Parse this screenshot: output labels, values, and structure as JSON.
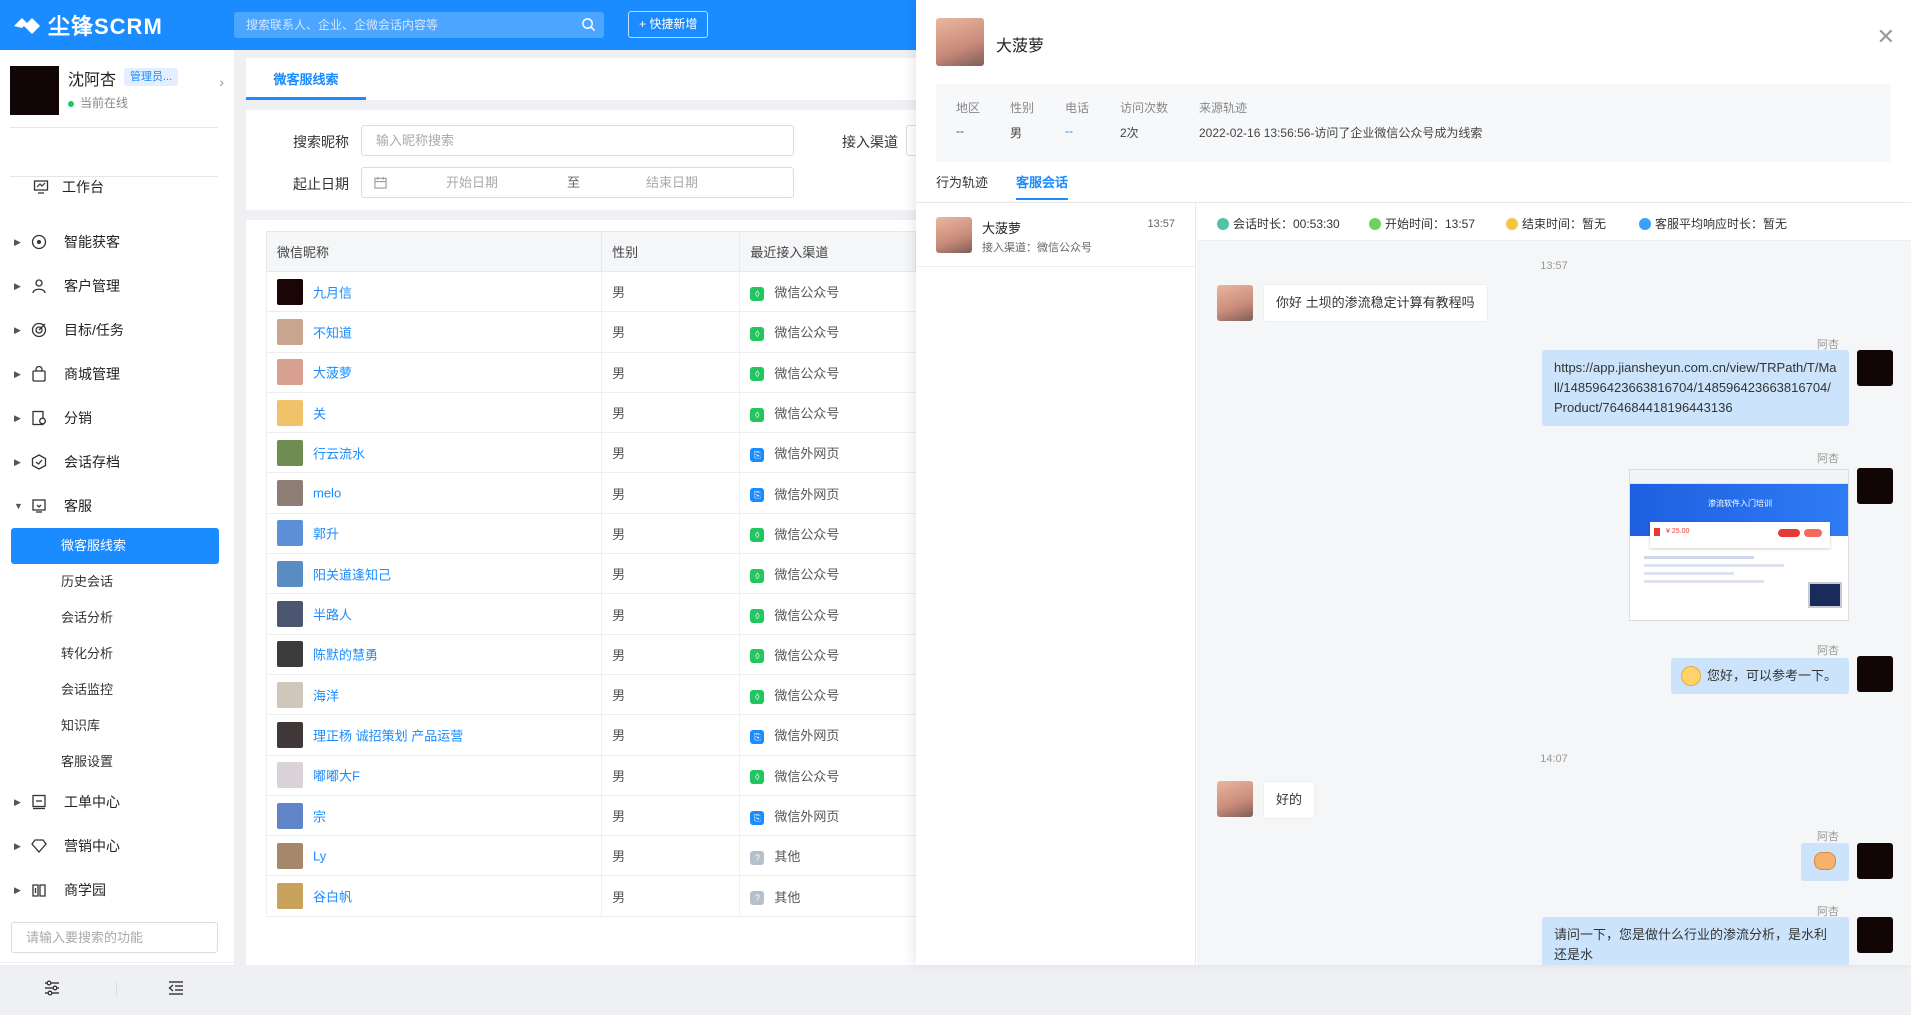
{
  "app": {
    "logo_text": "尘锋SCRM",
    "search_placeholder": "搜索联系人、企业、企微会话内容等",
    "quick_new": "+ 快捷新增"
  },
  "user": {
    "name": "沈阿杏",
    "role": "管理员...",
    "status": "当前在线"
  },
  "menu": {
    "workbench": "工作台",
    "items": [
      "智能获客",
      "客户管理",
      "目标/任务",
      "商城管理",
      "分销",
      "会话存档",
      "客服"
    ],
    "service_subs": [
      "微客服线索",
      "历史会话",
      "会话分析",
      "转化分析",
      "会话监控",
      "知识库",
      "客服设置"
    ],
    "bottom_items": [
      "工单中心",
      "营销中心",
      "商学园"
    ],
    "function_search_placeholder": "请输入要搜索的功能"
  },
  "page": {
    "tab": "微客服线索",
    "filters": {
      "nickname_label": "搜索昵称",
      "nickname_placeholder": "输入昵称搜索",
      "channel_label": "接入渠道",
      "date_label": "起止日期",
      "start_placeholder": "开始日期",
      "to": "至",
      "end_placeholder": "结束日期"
    },
    "table": {
      "headers": [
        "微信昵称",
        "性别",
        "最近接入渠道"
      ],
      "rows": [
        {
          "name": "九月信",
          "gender": "男",
          "channel": "微信公众号",
          "ch": "oa"
        },
        {
          "name": "不知道",
          "gender": "男",
          "channel": "微信公众号",
          "ch": "oa"
        },
        {
          "name": "大菠萝",
          "gender": "男",
          "channel": "微信公众号",
          "ch": "oa"
        },
        {
          "name": "关",
          "gender": "男",
          "channel": "微信公众号",
          "ch": "oa"
        },
        {
          "name": "行云流水",
          "gender": "男",
          "channel": "微信外网页",
          "ch": "web"
        },
        {
          "name": "melo",
          "gender": "男",
          "channel": "微信外网页",
          "ch": "web"
        },
        {
          "name": "郭升",
          "gender": "男",
          "channel": "微信公众号",
          "ch": "oa"
        },
        {
          "name": "阳关道逢知己",
          "gender": "男",
          "channel": "微信公众号",
          "ch": "oa"
        },
        {
          "name": "半路人",
          "gender": "男",
          "channel": "微信公众号",
          "ch": "oa"
        },
        {
          "name": "陈默的慧勇",
          "gender": "男",
          "channel": "微信公众号",
          "ch": "oa"
        },
        {
          "name": "海洋",
          "gender": "男",
          "channel": "微信公众号",
          "ch": "oa"
        },
        {
          "name": "理正杨 诚招策划 产品运营",
          "gender": "男",
          "channel": "微信外网页",
          "ch": "web"
        },
        {
          "name": "嘟嘟大F",
          "gender": "男",
          "channel": "微信公众号",
          "ch": "oa"
        },
        {
          "name": "宗",
          "gender": "男",
          "channel": "微信外网页",
          "ch": "web"
        },
        {
          "name": "Ly",
          "gender": "男",
          "channel": "其他",
          "ch": "other"
        },
        {
          "name": "谷白帆",
          "gender": "男",
          "channel": "其他",
          "ch": "other"
        }
      ]
    }
  },
  "detail": {
    "name": "大菠萝",
    "info_labels": [
      "地区",
      "性别",
      "电话",
      "访问次数",
      "来源轨迹"
    ],
    "info_values": [
      "--",
      "男",
      "--",
      "2次",
      "2022-02-16 13:56:56-访问了企业微信公众号成为线索"
    ],
    "tabs": [
      "行为轨迹",
      "客服会话"
    ],
    "conversation": {
      "name": "大菠萝",
      "channel": "接入渠道：微信公众号",
      "time": "13:57"
    },
    "stats": [
      "会话时长：00:53:30",
      "开始时间：13:57",
      "结束时间：暂无",
      "客服平均响应时长：暂无"
    ],
    "messages": {
      "t1": "13:57",
      "m1": "你好 土坝的渗流稳定计算有教程吗",
      "agent": "阿杏",
      "m2": "https://app.jiansheyun.com.cn/view/TRPath/T/Mall/1485964236638167​04/148596423663816704/Product/764684418196443136",
      "screenshot_title": "渗流软件入门培训",
      "screenshot_price": "¥ 25.00",
      "m3": "您好，可以参考一下。",
      "t2": "14:07",
      "m4": "好的",
      "m5": "请问一下，您是做什么行业的渗流分析，是水利还是水"
    }
  },
  "colors": {
    "primary": "#1a8cff",
    "oa": "#22c55e",
    "web": "#1a8cff",
    "other": "#b8bfcc"
  }
}
